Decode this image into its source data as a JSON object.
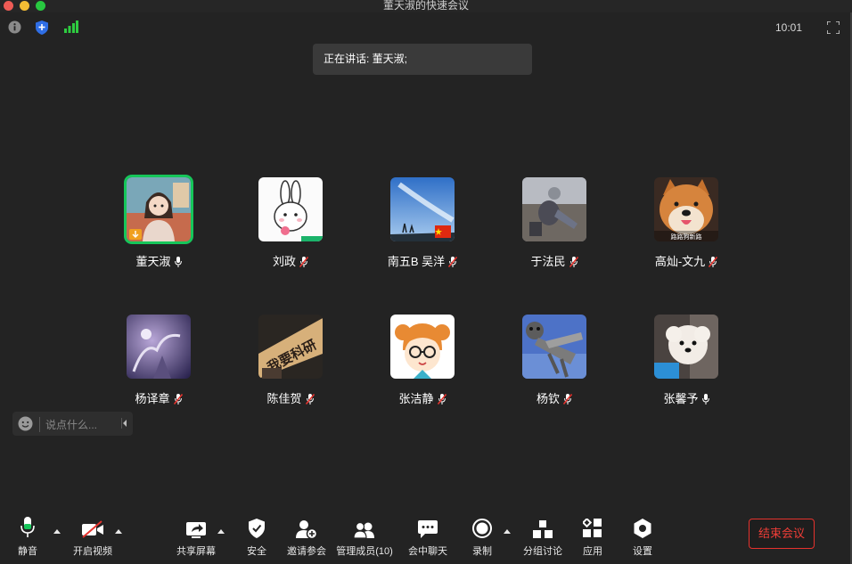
{
  "window": {
    "title": "董天淑的快速会议"
  },
  "topbar": {
    "clock": "10:01"
  },
  "speaking": {
    "text": "正在讲话: 董天淑;"
  },
  "participants": [
    {
      "name": "董天淑",
      "mic": "on",
      "active": true
    },
    {
      "name": "刘政",
      "mic": "muted"
    },
    {
      "name": "南五B 吴洋",
      "mic": "muted"
    },
    {
      "name": "于法民",
      "mic": "muted"
    },
    {
      "name": "高灿-文九",
      "mic": "muted"
    },
    {
      "name": "杨译章",
      "mic": "muted"
    },
    {
      "name": "陈佳贺",
      "mic": "muted"
    },
    {
      "name": "张洁静",
      "mic": "muted"
    },
    {
      "name": "杨钦",
      "mic": "muted"
    },
    {
      "name": "张馨予",
      "mic": "on"
    }
  ],
  "avatar_text": {
    "shiba": "路路狗新路",
    "poster": "我要科研"
  },
  "chat": {
    "placeholder": "说点什么..."
  },
  "toolbar": {
    "mute": "静音",
    "video": "开启视频",
    "share": "共享屏幕",
    "security": "安全",
    "invite": "邀请参会",
    "manage": "管理成员(10)",
    "chat": "会中聊天",
    "record": "录制",
    "breakout": "分组讨论",
    "apps": "应用",
    "settings": "设置",
    "end": "结束会议"
  },
  "colors": {
    "active_border": "#16c65a",
    "end_red": "#e5322d",
    "background": "#232323"
  }
}
